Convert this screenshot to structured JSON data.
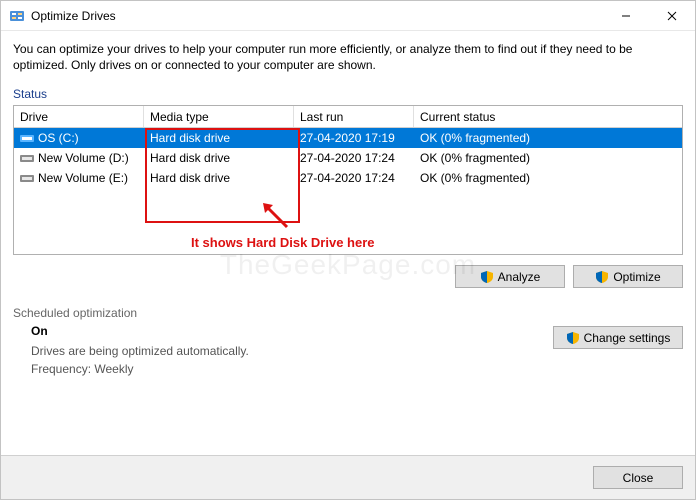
{
  "window": {
    "title": "Optimize Drives"
  },
  "intro": "You can optimize your drives to help your computer run more efficiently, or analyze them to find out if they need to be optimized. Only drives on or connected to your computer are shown.",
  "status_label": "Status",
  "columns": {
    "drive": "Drive",
    "media_type": "Media type",
    "last_run": "Last run",
    "current_status": "Current status"
  },
  "rows": [
    {
      "drive": "OS (C:)",
      "media_type": "Hard disk drive",
      "last_run": "27-04-2020 17:19",
      "status": "OK (0% fragmented)",
      "selected": true,
      "os": true
    },
    {
      "drive": "New Volume (D:)",
      "media_type": "Hard disk drive",
      "last_run": "27-04-2020 17:24",
      "status": "OK (0% fragmented)",
      "selected": false,
      "os": false
    },
    {
      "drive": "New Volume (E:)",
      "media_type": "Hard disk drive",
      "last_run": "27-04-2020 17:24",
      "status": "OK (0% fragmented)",
      "selected": false,
      "os": false
    }
  ],
  "buttons": {
    "analyze": "Analyze",
    "optimize": "Optimize",
    "change_settings": "Change settings",
    "close": "Close"
  },
  "sched": {
    "label": "Scheduled optimization",
    "state": "On",
    "desc": "Drives are being optimized automatically.",
    "freq": "Frequency: Weekly"
  },
  "annotation": {
    "text": "It shows Hard Disk Drive here"
  },
  "watermark": "TheGeekPage.com"
}
